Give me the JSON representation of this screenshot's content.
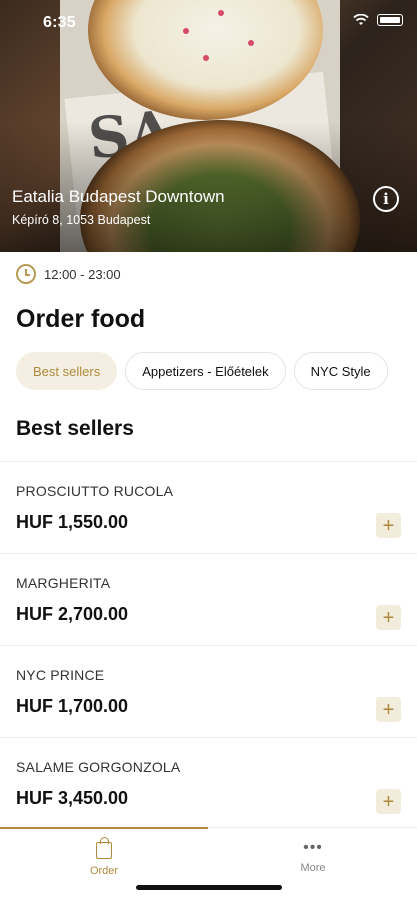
{
  "status_bar": {
    "time": "6:35"
  },
  "venue": {
    "name": "Eatalia Budapest Downtown",
    "address": "Képíró 8, 1053 Budapest",
    "hours": "12:00 - 23:00"
  },
  "page": {
    "title": "Order food"
  },
  "tabs": [
    {
      "label": "Best sellers",
      "active": true
    },
    {
      "label": "Appetizers - Előételek",
      "active": false
    },
    {
      "label": "NYC Style",
      "active": false
    }
  ],
  "section": {
    "title": "Best sellers"
  },
  "items": [
    {
      "name": "PROSCIUTTO RUCOLA",
      "price": "HUF 1,550.00"
    },
    {
      "name": "MARGHERITA",
      "price": "HUF 2,700.00"
    },
    {
      "name": "NYC PRINCE",
      "price": "HUF 1,700.00"
    },
    {
      "name": "SALAME GORGONZOLA",
      "price": "HUF 3,450.00"
    }
  ],
  "add_symbol": "+",
  "info_symbol": "i",
  "nav": {
    "order_label": "Order",
    "more_label": "More",
    "more_symbol": "•••"
  },
  "icons": {
    "info": "info-icon",
    "clock": "clock-icon",
    "add": "plus-icon",
    "order": "shopping-bag-icon",
    "more": "more-dots-icon"
  },
  "colors": {
    "accent": "#b08a3c",
    "accent_bg": "#f4efe2"
  }
}
